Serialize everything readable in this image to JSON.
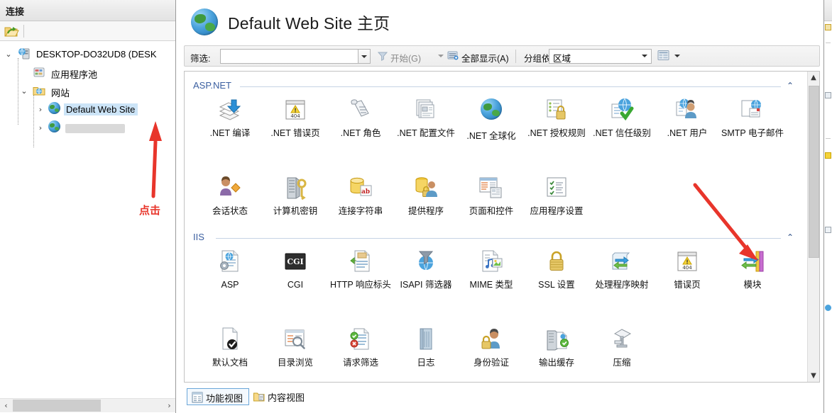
{
  "left_pane": {
    "title": "连接",
    "toolbar": {
      "connect_icon": "connect-to-site-icon"
    },
    "tree": [
      {
        "label": "DESKTOP-DO32UD8 (DESK",
        "icon": "server-icon",
        "expanded": true,
        "level": 0,
        "selected": false
      },
      {
        "label": "应用程序池",
        "icon": "app-pools-icon",
        "expanded": null,
        "level": 1,
        "selected": false
      },
      {
        "label": "网站",
        "icon": "sites-folder-icon",
        "expanded": true,
        "level": 1,
        "selected": false
      },
      {
        "label": "Default Web Site",
        "icon": "website-globe-icon",
        "expanded": false,
        "level": 2,
        "selected": true
      },
      {
        "label": "",
        "icon": "website-globe-icon",
        "expanded": false,
        "level": 2,
        "selected": false,
        "redacted": true
      }
    ]
  },
  "header": {
    "icon": "website-globe-icon",
    "title": "Default Web Site 主页"
  },
  "filter_bar": {
    "filter_label": "筛选:",
    "filter_value": "",
    "filter_placeholder": "",
    "go_label": "开始(G)",
    "go_icon": "funnel-icon",
    "show_all_label": "全部显示(A)",
    "show_all_icon": "show-all-icon",
    "group_by_label": "分组依据:",
    "group_by_value": "区域",
    "view_icon": "view-mode-icon"
  },
  "groups": [
    {
      "name": "ASP.NET",
      "collapse_icon": "chevron-up-icon",
      "items": [
        {
          "label": ".NET 编译",
          "icon": "net-compilation-icon"
        },
        {
          "label": ".NET 错误页",
          "icon": "net-error-pages-icon"
        },
        {
          "label": ".NET 角色",
          "icon": "net-roles-icon"
        },
        {
          "label": ".NET 配置文件",
          "icon": "net-profile-icon"
        },
        {
          "label": ".NET 全球化",
          "icon": "net-globalization-icon"
        },
        {
          "label": ".NET 授权规则",
          "icon": "net-authorization-rules-icon"
        },
        {
          "label": ".NET 信任级别",
          "icon": "net-trust-levels-icon"
        },
        {
          "label": ".NET 用户",
          "icon": "net-users-icon"
        },
        {
          "label": "SMTP 电子邮件",
          "icon": "smtp-email-icon"
        },
        {
          "label": "会话状态",
          "icon": "session-state-icon"
        },
        {
          "label": "计算机密钥",
          "icon": "machine-key-icon"
        },
        {
          "label": "连接字符串",
          "icon": "connection-strings-icon"
        },
        {
          "label": "提供程序",
          "icon": "providers-icon"
        },
        {
          "label": "页面和控件",
          "icon": "pages-and-controls-icon"
        },
        {
          "label": "应用程序设置",
          "icon": "application-settings-icon"
        }
      ]
    },
    {
      "name": "IIS",
      "collapse_icon": "chevron-up-icon",
      "items": [
        {
          "label": "ASP",
          "icon": "asp-icon"
        },
        {
          "label": "CGI",
          "icon": "cgi-icon"
        },
        {
          "label": "HTTP 响应标头",
          "icon": "http-response-headers-icon"
        },
        {
          "label": "ISAPI 筛选器",
          "icon": "isapi-filters-icon"
        },
        {
          "label": "MIME 类型",
          "icon": "mime-types-icon"
        },
        {
          "label": "SSL 设置",
          "icon": "ssl-settings-icon"
        },
        {
          "label": "处理程序映射",
          "icon": "handler-mappings-icon"
        },
        {
          "label": "错误页",
          "icon": "error-pages-icon"
        },
        {
          "label": "模块",
          "icon": "modules-icon"
        },
        {
          "label": "默认文档",
          "icon": "default-document-icon"
        },
        {
          "label": "目录浏览",
          "icon": "directory-browsing-icon"
        },
        {
          "label": "请求筛选",
          "icon": "request-filtering-icon"
        },
        {
          "label": "日志",
          "icon": "logging-icon"
        },
        {
          "label": "身份验证",
          "icon": "authentication-icon"
        },
        {
          "label": "输出缓存",
          "icon": "output-caching-icon"
        },
        {
          "label": "压缩",
          "icon": "compression-icon"
        }
      ]
    }
  ],
  "view_tabs": [
    {
      "label": "功能视图",
      "icon": "features-view-icon",
      "active": true
    },
    {
      "label": "内容视图",
      "icon": "content-view-icon",
      "active": false
    }
  ],
  "annotations": {
    "click_text": "点击",
    "color": "#e8352b",
    "arrow_sidebar": "arrow-up-pointing-to-default-web-site",
    "arrow_modules": "arrow-down-right-pointing-to-modules"
  },
  "scrollbars": {
    "content_up": "▲",
    "content_down": "▼",
    "left_prev": "‹",
    "left_next": "›"
  }
}
